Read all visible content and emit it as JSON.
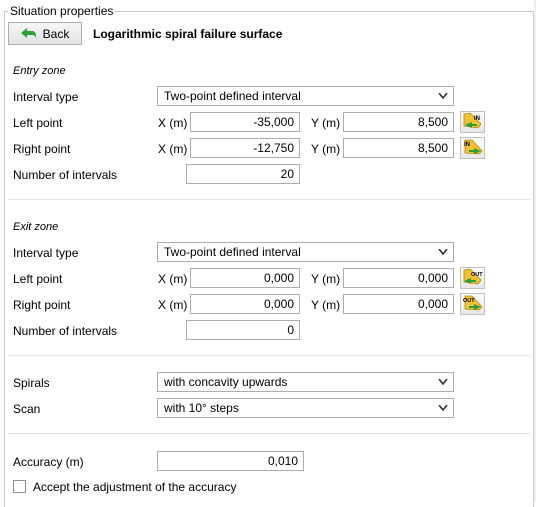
{
  "group_title": "Situation properties",
  "back_label": "Back",
  "page_title": "Logarithmic spiral failure surface",
  "entry": {
    "heading": "Entry zone",
    "interval_type_label": "Interval type",
    "interval_type_value": "Two-point defined interval",
    "left_label": "Left point",
    "left_x": "-35,000",
    "left_y": "8,500",
    "right_label": "Right point",
    "right_x": "-12,750",
    "right_y": "8,500",
    "intervals_label": "Number of intervals",
    "intervals_value": "20"
  },
  "exit": {
    "heading": "Exit zone",
    "interval_type_label": "Interval type",
    "interval_type_value": "Two-point defined interval",
    "left_label": "Left point",
    "left_x": "0,000",
    "left_y": "0,000",
    "right_label": "Right point",
    "right_x": "0,000",
    "right_y": "0,000",
    "intervals_label": "Number of intervals",
    "intervals_value": "0"
  },
  "coord_labels": {
    "x": "X (m)",
    "y": "Y (m)"
  },
  "pick_icons": {
    "in": "IN",
    "out": "OUT"
  },
  "spirals": {
    "label": "Spirals",
    "value": "with concavity upwards"
  },
  "scan": {
    "label": "Scan",
    "value": "with 10° steps"
  },
  "accuracy": {
    "label": "Accuracy (m)",
    "value": "0,010"
  },
  "accept_label": "Accept the adjustment of the accuracy",
  "colors": {
    "arrow_green": "#2e9e3a",
    "icon_yellow": "#f2c230"
  }
}
